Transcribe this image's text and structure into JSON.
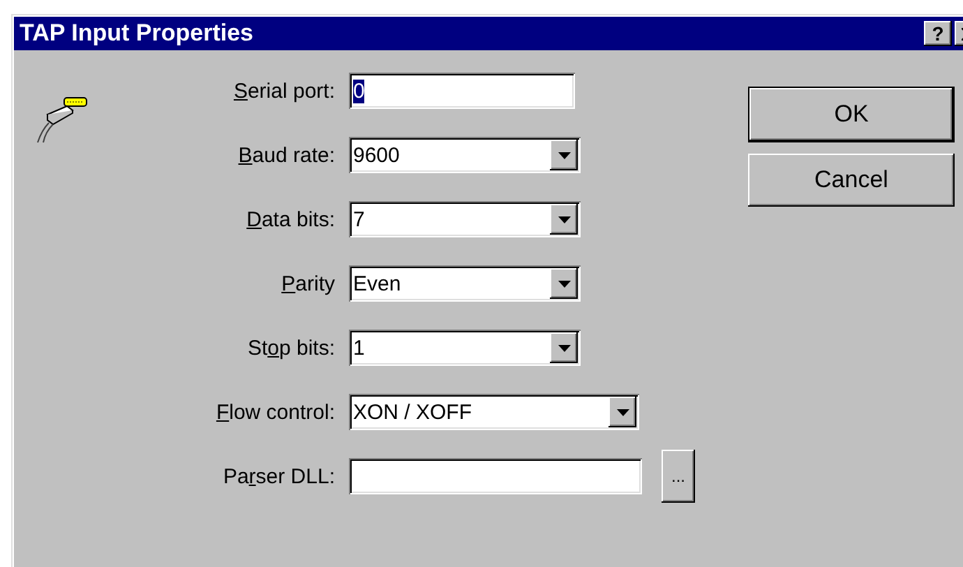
{
  "window": {
    "title": "TAP Input Properties",
    "help_button": "?"
  },
  "fields": [
    {
      "kind": "text",
      "access_key": "S",
      "label_end": "erial port:",
      "value": "0",
      "selected": true
    },
    {
      "kind": "combo",
      "access_key": "B",
      "label_end": "aud rate:",
      "value": "9600"
    },
    {
      "kind": "combo",
      "access_key": "D",
      "label_end": "ata bits:",
      "value": "7"
    },
    {
      "kind": "combo",
      "access_key": "P",
      "label_end": "arity",
      "value": "Even"
    },
    {
      "kind": "combo",
      "label_start": "St",
      "access_key": "o",
      "label_end": "p bits:",
      "value": "1"
    },
    {
      "kind": "wide_combo",
      "access_key": "F",
      "label_end": "low control:",
      "value": "XON / XOFF"
    },
    {
      "kind": "file",
      "label_start": "Pa",
      "access_key": "r",
      "label_end": "ser DLL:",
      "browse": "..."
    }
  ],
  "buttons": [
    {
      "label": "OK",
      "default": true
    },
    {
      "label": "Cancel",
      "default": false
    }
  ]
}
